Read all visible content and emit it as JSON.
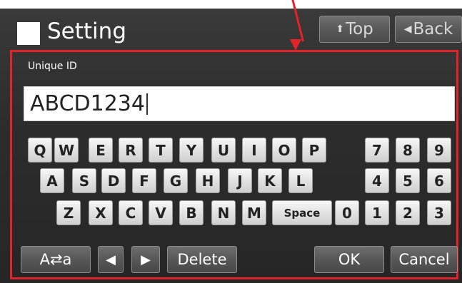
{
  "header": {
    "title": "Setting",
    "top_button": {
      "glyph": "⬆",
      "label": "Top"
    },
    "back_button": {
      "glyph": "◀",
      "label": "Back"
    }
  },
  "form": {
    "field_label": "Unique ID",
    "field_value": "ABCD1234"
  },
  "keyboard": {
    "row1": [
      "Q",
      "W",
      "E",
      "R",
      "T",
      "Y",
      "U",
      "I",
      "O",
      "P"
    ],
    "row2": [
      "A",
      "S",
      "D",
      "F",
      "G",
      "H",
      "J",
      "K",
      "L"
    ],
    "row3": [
      "Z",
      "X",
      "C",
      "V",
      "B",
      "N",
      "M"
    ],
    "space_label": "Space",
    "numpad_row1": [
      "7",
      "8",
      "9"
    ],
    "numpad_row2": [
      "4",
      "5",
      "6"
    ],
    "numpad_row3": [
      "0",
      "1",
      "2",
      "3"
    ]
  },
  "footer": {
    "case_toggle": "A⇄a",
    "cursor_left": "◀",
    "cursor_right": "▶",
    "delete": "Delete",
    "ok": "OK",
    "cancel": "Cancel"
  },
  "colors": {
    "annotation": "#e3222a",
    "panel_background": "#2d2d2d",
    "key_face": "#e6e6e6"
  }
}
